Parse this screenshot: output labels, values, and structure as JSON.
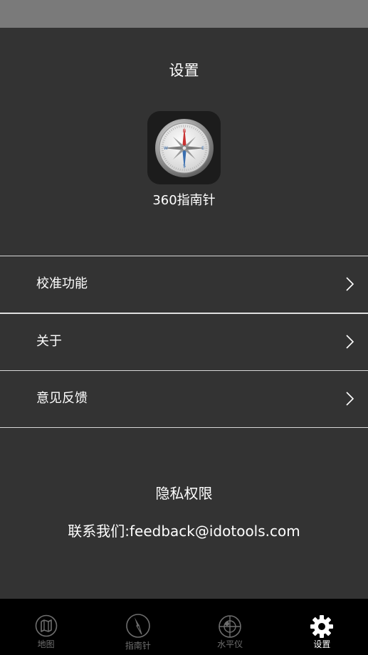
{
  "header": {
    "title": "设置"
  },
  "app": {
    "name": "360指南针",
    "icon": "compass-icon"
  },
  "menu": {
    "items": [
      {
        "label": "校准功能",
        "icon": "chevron-right-icon"
      },
      {
        "label": "关于",
        "icon": "chevron-right-icon"
      },
      {
        "label": "意见反馈",
        "icon": "chevron-right-icon"
      }
    ]
  },
  "footer": {
    "privacy": "隐私权限",
    "contact": "联系我们:feedback@idotools.com"
  },
  "tabs": [
    {
      "label": "地图",
      "icon": "map-icon",
      "active": false
    },
    {
      "label": "指南针",
      "icon": "compass-needle-icon",
      "active": false
    },
    {
      "label": "水平仪",
      "icon": "level-icon",
      "active": false
    },
    {
      "label": "设置",
      "icon": "gear-icon",
      "active": true
    }
  ],
  "colors": {
    "background": "#333333",
    "status_bar": "#7a7a7a",
    "tab_bar": "#000000",
    "tab_inactive": "#6e6e6e",
    "tab_active": "#ffffff",
    "divider": "#d8d8d8"
  }
}
